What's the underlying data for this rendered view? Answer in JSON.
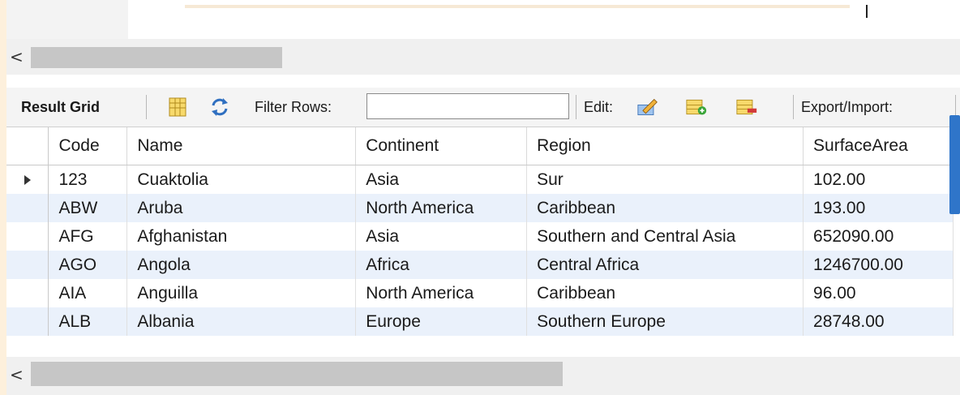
{
  "toolbar": {
    "result_grid_label": "Result Grid",
    "filter_label": "Filter Rows:",
    "filter_value": "",
    "edit_label": "Edit:",
    "export_label": "Export/Import:"
  },
  "grid": {
    "columns": [
      "Code",
      "Name",
      "Continent",
      "Region",
      "SurfaceArea"
    ],
    "rows": [
      [
        "123",
        "Cuaktolia",
        "Asia",
        "Sur",
        "102.00"
      ],
      [
        "ABW",
        "Aruba",
        "North America",
        "Caribbean",
        "193.00"
      ],
      [
        "AFG",
        "Afghanistan",
        "Asia",
        "Southern and Central Asia",
        "652090.00"
      ],
      [
        "AGO",
        "Angola",
        "Africa",
        "Central Africa",
        "1246700.00"
      ],
      [
        "AIA",
        "Anguilla",
        "North America",
        "Caribbean",
        "96.00"
      ],
      [
        "ALB",
        "Albania",
        "Europe",
        "Southern Europe",
        "28748.00"
      ]
    ],
    "selected_row": 0
  },
  "scroll": {
    "left_arrow": "<"
  },
  "colors": {
    "accent": "#2f75c9",
    "row_alt": "#eaf1fb",
    "page_bg": "#fdf0dc"
  }
}
